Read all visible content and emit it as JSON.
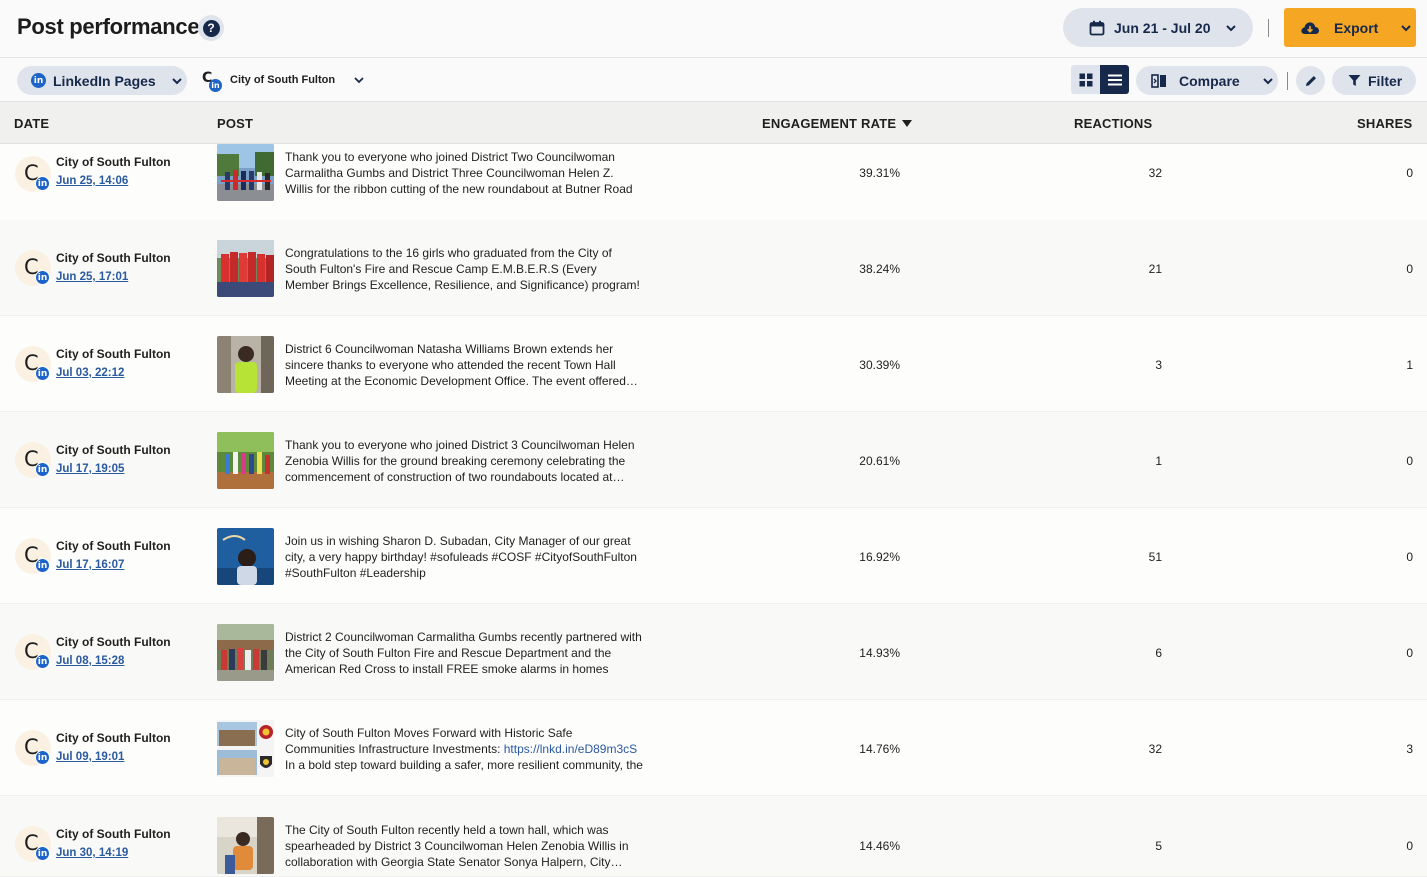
{
  "header": {
    "title": "Post performance",
    "help_icon": "?",
    "date_range": "Jun 21 - Jul 20",
    "export_label": "Export"
  },
  "filters": {
    "network_label": "LinkedIn Pages",
    "network_badge": "in",
    "profile_name": "City of South Fulton",
    "profile_initial": "C",
    "compare_label": "Compare",
    "filter_label": "Filter"
  },
  "columns": {
    "date": "DATE",
    "post": "POST",
    "engagement": "ENGAGEMENT RATE",
    "reactions": "REACTIONS",
    "shares": "SHARES"
  },
  "colors": {
    "navy": "#17294a",
    "pill": "#dfe4ec",
    "accent": "#f5a623",
    "link": "#2a5aa0",
    "linkedin": "#1e64c8"
  },
  "rows": [
    {
      "account": "City of South Fulton",
      "initial": "C",
      "badge": "in",
      "date": "Jun 25, 14:06",
      "text": "Thank you to everyone who joined District Two Councilwoman Carmalitha Gumbs and District Three Councilwoman Helen Z. Willis for the ribbon cutting of the new roundabout at Butner Road and…",
      "engagement": "39.31%",
      "reactions": "32",
      "shares": "0"
    },
    {
      "account": "City of South Fulton",
      "initial": "C",
      "badge": "in",
      "date": "Jun 25, 17:01",
      "text": "Congratulations to the 16 girls who graduated from the City of South Fulton's Fire and Rescue Camp E.M.B.E.R.S (Every Member Brings Excellence, Resilience, and Significance) program! Founde…",
      "engagement": "38.24%",
      "reactions": "21",
      "shares": "0"
    },
    {
      "account": "City of South Fulton",
      "initial": "C",
      "badge": "in",
      "date": "Jul 03, 22:12",
      "text": "District 6 Councilwoman Natasha Williams Brown extends her sincere thanks to everyone who attended the recent Town Hall Meeting at the Economic Development Office. The event offered…",
      "engagement": "30.39%",
      "reactions": "3",
      "shares": "1"
    },
    {
      "account": "City of South Fulton",
      "initial": "C",
      "badge": "in",
      "date": "Jul 17, 19:05",
      "text": "Thank you to everyone who joined District 3 Councilwoman Helen Zenobia Willis for the ground breaking ceremony celebrating the commencement of construction of two roundabouts located at…",
      "engagement": "20.61%",
      "reactions": "1",
      "shares": "0"
    },
    {
      "account": "City of South Fulton",
      "initial": "C",
      "badge": "in",
      "date": "Jul 17, 16:07",
      "text": "Join us in wishing Sharon D. Subadan, City Manager of our great city, a very happy birthday! #sofuleads #COSF #CityofSouthFulton #SouthFulton #Leadership",
      "engagement": "16.92%",
      "reactions": "51",
      "shares": "0"
    },
    {
      "account": "City of South Fulton",
      "initial": "C",
      "badge": "in",
      "date": "Jul 08, 15:28",
      "text": "District 2 Councilwoman Carmalitha Gumbs recently partnered with the City of South Fulton Fire and Rescue Department and the American Red Cross to install FREE smoke alarms in homes across…",
      "engagement": "14.93%",
      "reactions": "6",
      "shares": "0"
    },
    {
      "account": "City of South Fulton",
      "initial": "C",
      "badge": "in",
      "date": "Jul 09, 19:01",
      "text_before": "City of South Fulton Moves Forward with Historic Safe Communities Infrastructure Investments: ",
      "link": "https://lnkd.in/eD89m3cS",
      "text_after": " In a bold step toward building a safer, more resilient community, the City of Sou…",
      "engagement": "14.76%",
      "reactions": "32",
      "shares": "3"
    },
    {
      "account": "City of South Fulton",
      "initial": "C",
      "badge": "in",
      "date": "Jun 30, 14:19",
      "text": "The City of South Fulton recently held a town hall, which was spearheaded by District 3 Councilwoman Helen Zenobia Willis in collaboration with Georgia State Senator Sonya Halpern, City…",
      "engagement": "14.46%",
      "reactions": "5",
      "shares": "0"
    }
  ]
}
